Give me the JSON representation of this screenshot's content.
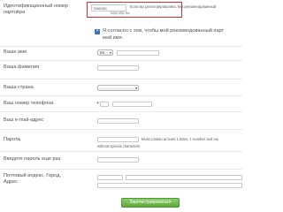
{
  "form": {
    "partner_id": {
      "label": "Идентификационный номер партнёра",
      "value": "7483190",
      "hint_top": "Если вы регистрировались без рекомендованный",
      "hint_bottom": "партнёр на"
    },
    "agree": {
      "checked": true,
      "text_line1": "Я согласен с тем, чтобы мой рекомендованный парт",
      "text_line2": "мой имя."
    },
    "first_name": {
      "label": "Ваше имя",
      "title_select": "Mr",
      "value": ""
    },
    "last_name": {
      "label": "Ваша фамилия",
      "value": ""
    },
    "country": {
      "label": "Ваша страна",
      "value": ""
    },
    "phone": {
      "label": "Ваш номер телефона",
      "prefix": "+",
      "code": "",
      "number": ""
    },
    "email": {
      "label": "Ваш e-mail-адрес",
      "value": ""
    },
    "password": {
      "label": "Пароль",
      "value": "",
      "hint_line1": "Must contain at least 1 letter, 1 number and mu",
      "hint_line2": "without special characters"
    },
    "password_repeat": {
      "label": "Введите пароль еще раз",
      "value": ""
    },
    "address": {
      "label_line1": "Почтовый индекс, Город,",
      "label_line2": "Адрес",
      "zip": "",
      "city": "",
      "street": ""
    },
    "submit_label": "Зарегистрироваться"
  },
  "colors": {
    "highlight_border": "#d32f2f",
    "button": "#5aa83b",
    "checkbox": "#3b6fd1"
  }
}
